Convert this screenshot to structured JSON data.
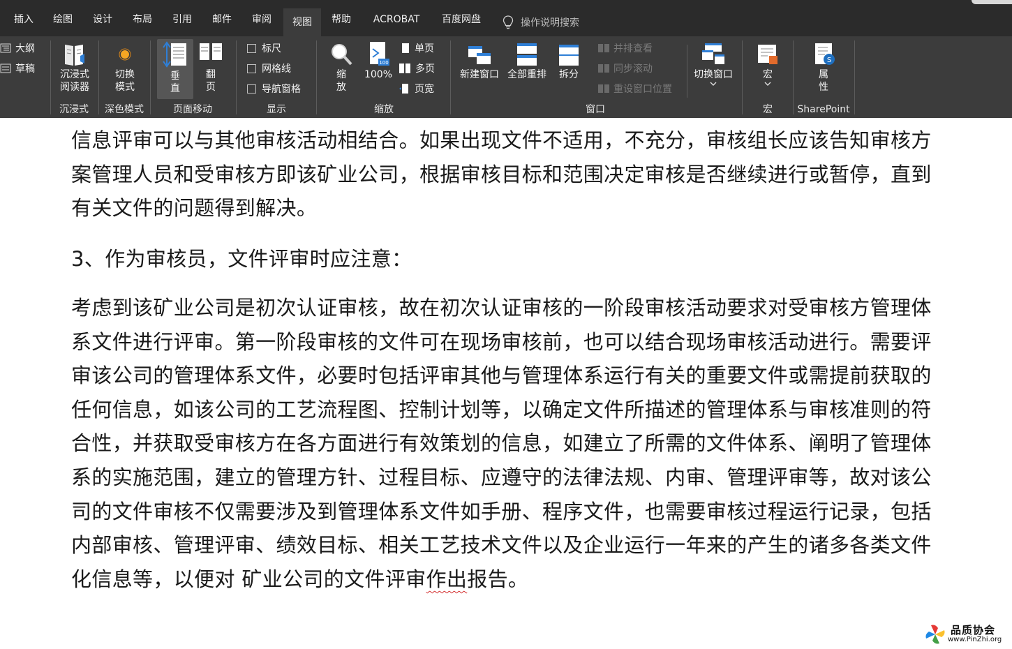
{
  "tabs": [
    {
      "label": "插入"
    },
    {
      "label": "绘图"
    },
    {
      "label": "设计"
    },
    {
      "label": "布局"
    },
    {
      "label": "引用"
    },
    {
      "label": "邮件"
    },
    {
      "label": "审阅"
    },
    {
      "label": "视图"
    },
    {
      "label": "帮助"
    },
    {
      "label": "ACROBAT"
    },
    {
      "label": "百度网盘"
    }
  ],
  "active_tab": "视图",
  "tell_me": "操作说明搜索",
  "ribbon": {
    "views": {
      "outline": "大纲",
      "draft": "草稿"
    },
    "immersive": {
      "reader_line1": "沉浸式",
      "reader_line2": "阅读器",
      "group": "沉浸式"
    },
    "dark_mode": {
      "switch_line1": "切换",
      "switch_line2": "模式",
      "group": "深色模式"
    },
    "page_movement": {
      "vertical_1": "垂",
      "vertical_2": "直",
      "side_1": "翻",
      "side_2": "页",
      "group": "页面移动"
    },
    "show": {
      "ruler": "标尺",
      "gridlines": "网格线",
      "nav_pane": "导航窗格",
      "group": "显示"
    },
    "zoom": {
      "zoom_1": "缩",
      "zoom_2": "放",
      "hundred": "100%",
      "one_page": "单页",
      "multi_page": "多页",
      "page_width": "页宽",
      "group": "缩放"
    },
    "window": {
      "new_window": "新建窗口",
      "arrange_all": "全部重排",
      "split": "拆分",
      "side_by_side": "并排查看",
      "sync_scroll": "同步滚动",
      "reset_pos": "重设窗口位置",
      "switch_windows": "切换窗口",
      "group": "窗口"
    },
    "macros": {
      "label": "宏",
      "group": "宏"
    },
    "sharepoint": {
      "prop_1": "属",
      "prop_2": "性",
      "group": "SharePoint"
    }
  },
  "document": {
    "p1": "信息评审可以与其他审核活动相结合。如果出现文件不适用，不充分，审核组长应该告知审核方案管理人员和受审核方即该矿业公司，根据审核目标和范围决定审核是否继续进行或暂停，直到有关文件的问题得到解决。",
    "p2": "3、作为审核员，文件评审时应注意：",
    "p3_main": "考虑到该矿业公司是初次认证审核，故在初次认证审核的一阶段审核活动要求对受审核方管理体系文件进行评审。第一阶段审核的文件可在现场审核前，也可以结合现场审核活动进行。需要评审该公司的管理体系文件，必要时包括评审其他与管理体系运行有关的重要文件或需提前获取的任何信息，如该公司的工艺流程图、控制计划等，以确定文件所描述的管理体系与审核准则的符合性，并获取受审核方在各方面进行有效策划的信息，如建立了所需的文件体系、阐明了管理体系的实施范围，建立的管理方针、过程目标、应遵守的法律法规、内审、管理评审等，故对该公司的文件审核不仅需要涉及到管理体系文件如手册、程序文件，也需要审核过程运行记录，包括内部审核、管理评审、绩效目标、相关工艺技术文件以及企业运行一年来的产生的诸多各类文件化信息等，以便对 矿业公司的文件评审",
    "p3_squiggle": "作出",
    "p3_end": "报告。"
  },
  "watermark": {
    "title": "品质协会",
    "url": "www.PinZhi.org"
  },
  "colors": {
    "tabbar": "#2b2b2b",
    "ribbon": "#3c3c3c",
    "text": "#1a1a1a",
    "accent_blue": "#2f7fd6",
    "squiggle": "#d32f2f"
  }
}
